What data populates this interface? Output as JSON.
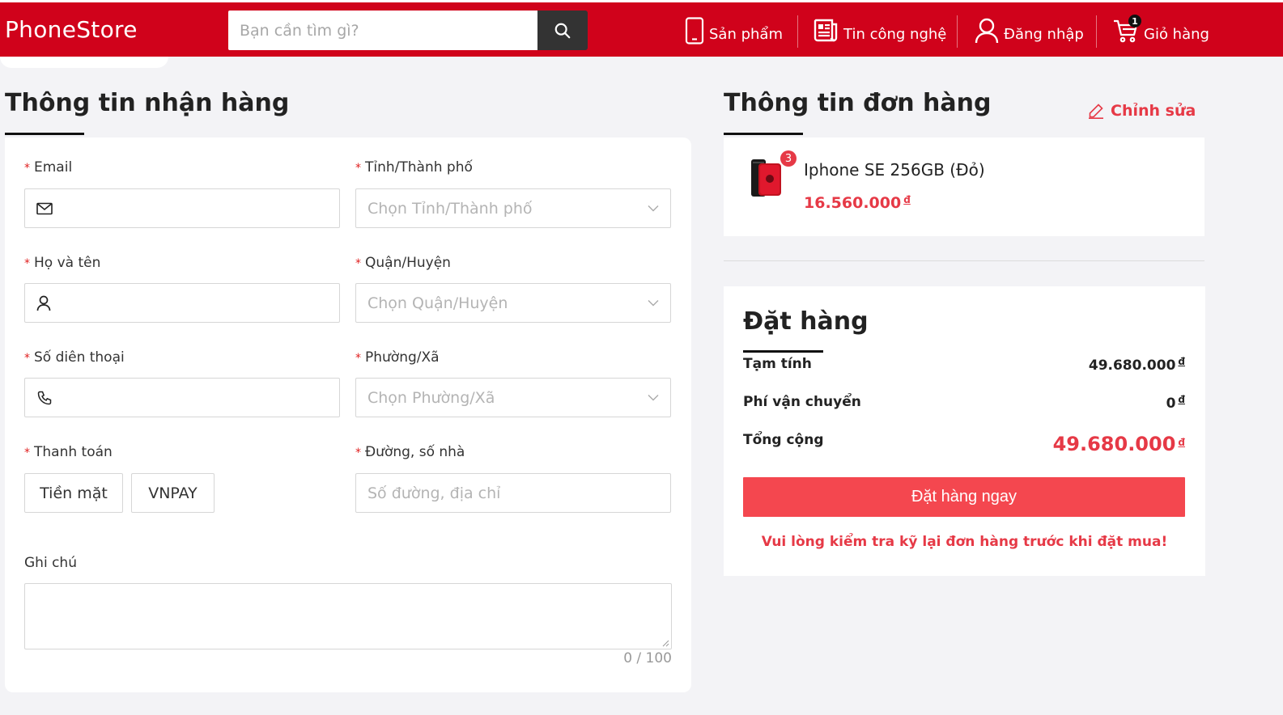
{
  "brand": {
    "logo": "PhoneStore",
    "accent": "#d0021b",
    "price_color": "#e63946",
    "button_color": "#f4474f"
  },
  "header": {
    "search_placeholder": "Bạn cần tìm gì?",
    "nav": [
      {
        "label": "Sản phẩm",
        "icon": "phone-icon"
      },
      {
        "label": "Tin công nghệ",
        "icon": "news-icon"
      },
      {
        "label": "Đăng nhập",
        "icon": "user-icon"
      },
      {
        "label": "Giỏ hàng",
        "icon": "cart-icon",
        "badge": "1"
      }
    ]
  },
  "form": {
    "title": "Thông tin nhận hàng",
    "email_label": "Email",
    "name_label": "Họ và tên",
    "phone_label": "Số diên thoại",
    "payment_label": "Thanh toán",
    "payment_options": [
      "Tiền mặt",
      "VNPAY"
    ],
    "province_label": "Tỉnh/Thành phố",
    "province_placeholder": "Chọn Tỉnh/Thành phố",
    "district_label": "Quận/Huyện",
    "district_placeholder": "Chọn Quận/Huyện",
    "ward_label": "Phường/Xã",
    "ward_placeholder": "Chọn Phường/Xã",
    "street_label": "Đường, số nhà",
    "street_placeholder": "Số đường, địa chỉ",
    "note_label": "Ghi chú",
    "note_counter": "0 / 100",
    "required_mark": "*"
  },
  "order_info": {
    "title": "Thông tin đơn hàng",
    "edit_label": "Chỉnh sửa",
    "product": {
      "name": "Iphone SE 256GB (Đỏ)",
      "price": "16.560.000",
      "quantity": "3",
      "currency": "đ"
    }
  },
  "checkout": {
    "title": "Đặt hàng",
    "subtotal_label": "Tạm tính",
    "subtotal_value": "49.680.000",
    "shipping_label": "Phí vận chuyển",
    "shipping_value": "0",
    "total_label": "Tổng cộng",
    "total_value": "49.680.000",
    "currency": "đ",
    "button_label": "Đặt hàng ngay",
    "warning": "Vui lòng kiểm tra kỹ lại đơn hàng trước khi đặt mua!"
  }
}
